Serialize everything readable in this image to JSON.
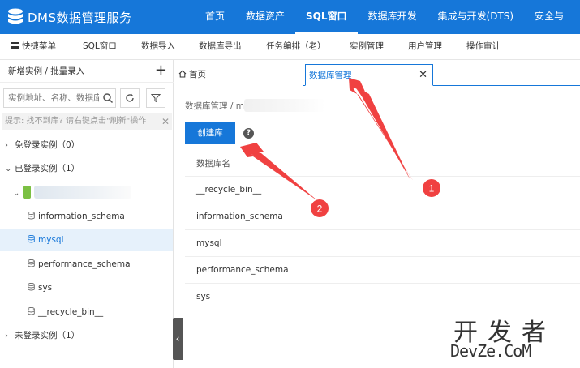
{
  "app": {
    "title": "DMS数据管理服务"
  },
  "topnav": [
    "首页",
    "数据资产",
    "SQL窗口",
    "数据库开发",
    "集成与开发(DTS)",
    "安全与"
  ],
  "subnav": {
    "quick_menu": "快捷菜单",
    "items": [
      "SQL窗口",
      "数据导入",
      "数据库导出",
      "任务编排（老）",
      "实例管理",
      "用户管理",
      "操作审计"
    ]
  },
  "sidebar": {
    "header": "新增实例 / 批量录入",
    "plus": "+",
    "search_placeholder": "实例地址、名称、数据库",
    "hint": "提示: 找不到库? 请右键点击\"刷新\"操作",
    "hint_close": "✕",
    "groups": [
      {
        "label": "免登录实例（0）",
        "caret": "›"
      },
      {
        "label": "已登录实例（1）",
        "caret": "⌄"
      },
      {
        "label": "未登录实例（1）",
        "caret": "›"
      }
    ],
    "instance_caret": "⌄",
    "databases": [
      "information_schema",
      "mysql",
      "performance_schema",
      "sys",
      "__recycle_bin__"
    ],
    "collapse": "‹"
  },
  "tabs": {
    "home": "首页",
    "active": "数据库管理",
    "close": "✕"
  },
  "content": {
    "breadcrumb": "数据库管理 / m",
    "create_button": "创建库",
    "help": "?",
    "table_header": "数据库名",
    "rows": [
      "__recycle_bin__",
      "information_schema",
      "mysql",
      "performance_schema",
      "sys"
    ]
  },
  "annotations": {
    "marker1": "1",
    "marker2": "2",
    "color": "#f04141"
  },
  "watermark": {
    "cn": "开发者",
    "en": "DevZe.CoM"
  },
  "colors": {
    "primary": "#1677d9"
  }
}
